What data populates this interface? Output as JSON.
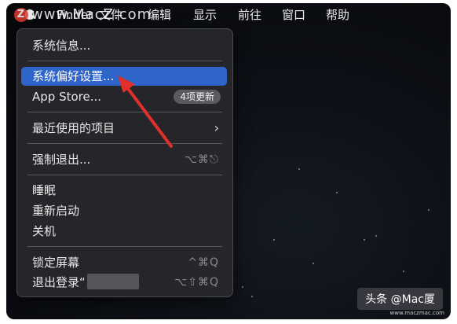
{
  "menubar": {
    "items": [
      "Finder",
      "文件",
      "编辑",
      "显示",
      "前往",
      "窗口",
      "帮助"
    ]
  },
  "watermark": {
    "badge": "Z",
    "text": "www.MacZ.com"
  },
  "apple_menu": {
    "items": [
      {
        "label": "系统信息..."
      },
      {
        "label": "系统偏好设置...",
        "selected": true
      },
      {
        "label": "App Store...",
        "badge": "4项更新"
      },
      {
        "label": "最近使用的项目",
        "submenu_icon": "chevron-right-icon"
      },
      {
        "label": "强制退出...",
        "shortcut": "⌥⌘⎋"
      },
      {
        "label": "睡眠"
      },
      {
        "label": "重新启动"
      },
      {
        "label": "关机"
      },
      {
        "label": "锁定屏幕",
        "shortcut": "^⌘Q"
      },
      {
        "label": "退出登录“",
        "shortcut": "⌥⇧⌘Q"
      }
    ]
  },
  "attribution": {
    "text": "头条 @Mac厦",
    "small": "www.maczmac.com"
  },
  "colors": {
    "selection": "#2f64c9",
    "arrow": "#e0302a",
    "menu_bg": "#28282c"
  }
}
